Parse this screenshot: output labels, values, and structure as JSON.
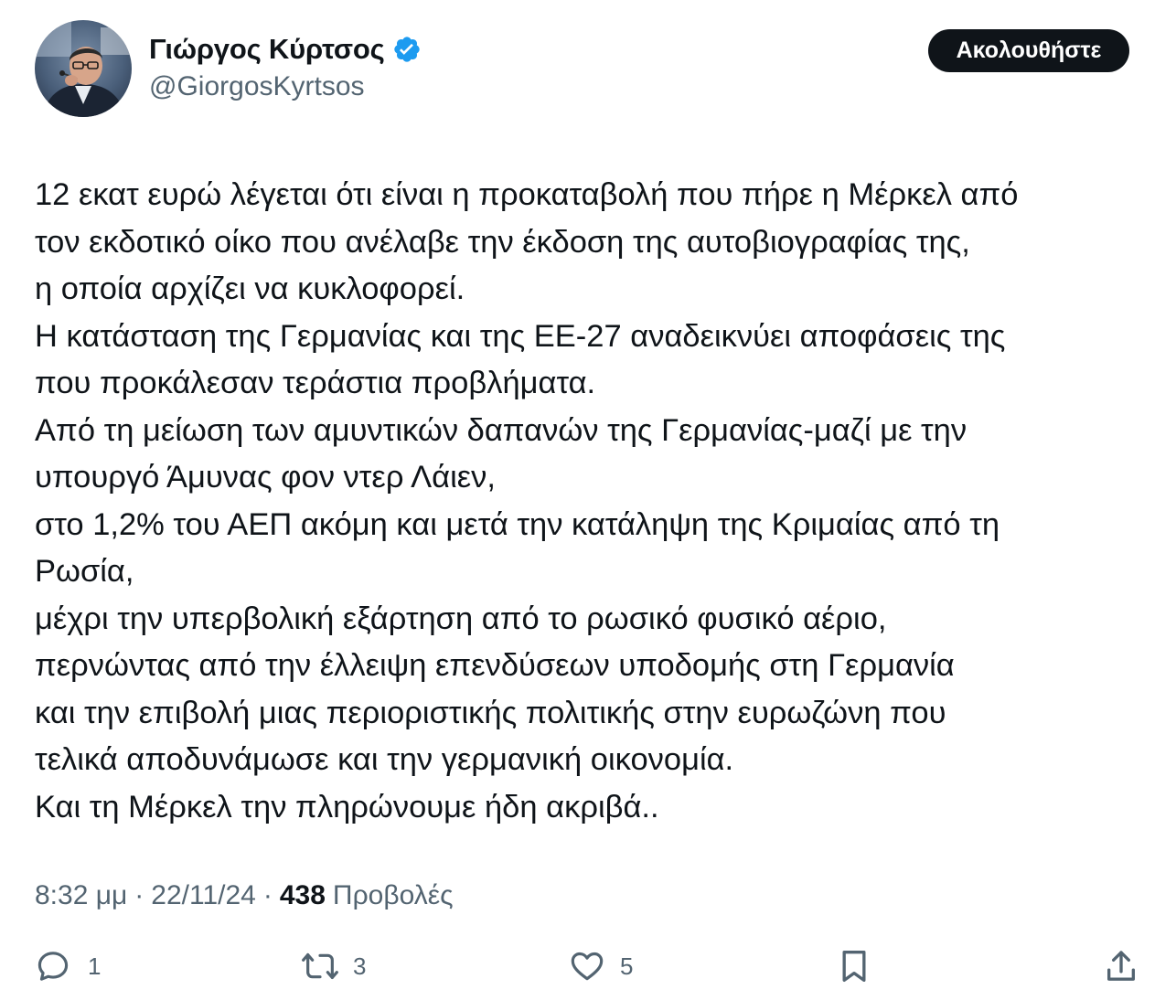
{
  "author": {
    "display_name": "Γιώργος Κύρτσος",
    "handle": "@GiorgosKyrtsos",
    "verified": true
  },
  "follow_button": {
    "label": "Ακολουθήστε"
  },
  "tweet": {
    "lines": [
      "12 εκατ ευρώ λέγεται ότι είναι η προκαταβολή που πήρε η Μέρκελ από",
      "τον εκδοτικό οίκο που ανέλαβε την έκδοση της αυτοβιογραφίας της,",
      "η οποία αρχίζει να κυκλοφορεί.",
      "Η κατάσταση της Γερμανίας και της ΕΕ-27 αναδεικνύει αποφάσεις της",
      "που προκάλεσαν τεράστια προβλήματα.",
      "Από τη μείωση των αμυντικών δαπανών της Γερμανίας-μαζί με την",
      "υπουργό Άμυνας φον ντερ Λάιεν,",
      "στο 1,2% του ΑΕΠ ακόμη και μετά την κατάληψη της Κριμαίας από τη",
      "Ρωσία,",
      "μέχρι την υπερβολική εξάρτηση από το ρωσικό φυσικό αέριο,",
      "περνώντας από την έλλειψη επενδύσεων υποδομής στη Γερμανία",
      "και την επιβολή μιας περιοριστικής πολιτικής στην ευρωζώνη που",
      "τελικά αποδυνάμωσε και την γερμανική οικονομία.",
      "Και τη Μέρκελ την πληρώνουμε ήδη ακριβά.."
    ]
  },
  "meta": {
    "time": "8:32 μμ",
    "separator": "·",
    "date": "22/11/24",
    "views_count": "438",
    "views_label": "Προβολές"
  },
  "actions": {
    "reply": {
      "icon": "reply-icon",
      "count": "1"
    },
    "retweet": {
      "icon": "retweet-icon",
      "count": "3"
    },
    "like": {
      "icon": "heart-icon",
      "count": "5"
    },
    "bookmark": {
      "icon": "bookmark-icon"
    },
    "share": {
      "icon": "share-icon"
    }
  },
  "colors": {
    "text_primary": "#0f1419",
    "text_secondary": "#536471",
    "verified_blue": "#1d9bf0",
    "button_bg": "#0f1419"
  }
}
